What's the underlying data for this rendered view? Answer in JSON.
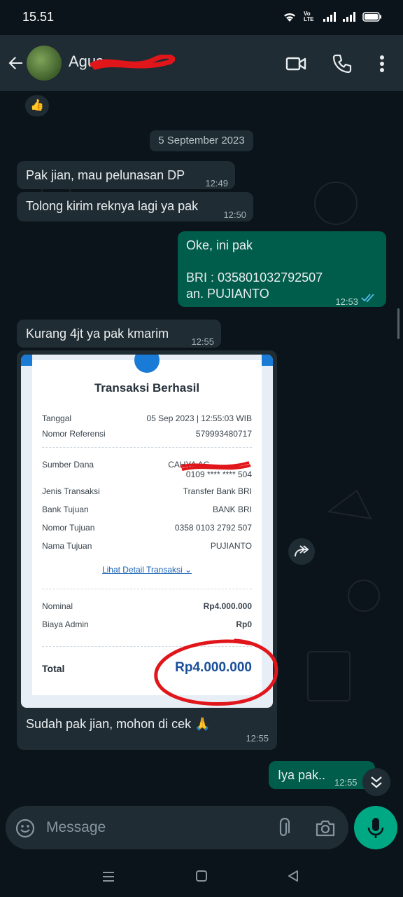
{
  "status_bar": {
    "time": "15.51",
    "network": "Vo LTE"
  },
  "header": {
    "contact_name": "Agus"
  },
  "chat": {
    "date_separator": "5 September 2023",
    "reaction": "👍",
    "messages": [
      {
        "text": "Pak jian, mau pelunasan DP",
        "time": "12:49"
      },
      {
        "text": "Tolong kirim reknya lagi ya pak",
        "time": "12:50"
      },
      {
        "line1": "Oke, ini pak",
        "line2": "BRI : 035801032792507",
        "line3": "an. PUJIANTO",
        "time": "12:53"
      },
      {
        "text": "Kurang 4jt ya pak kmarim",
        "time": "12:55"
      },
      {
        "caption": "Sudah pak jian, mohon di cek 🙏",
        "time": "12:55"
      },
      {
        "text": "Iya pak..",
        "time": "12:55"
      }
    ]
  },
  "receipt": {
    "title": "Transaksi Berhasil",
    "rows": [
      {
        "label": "Tanggal",
        "value": "05 Sep 2023 | 12:55:03 WIB"
      },
      {
        "label": "Nomor Referensi",
        "value": "579993480717"
      },
      {
        "label": "Sumber Dana",
        "value": "CAHYA AG",
        "value2": "0109 **** **** 504"
      },
      {
        "label": "Jenis Transaksi",
        "value": "Transfer Bank BRI"
      },
      {
        "label": "Bank Tujuan",
        "value": "BANK BRI"
      },
      {
        "label": "Nomor Tujuan",
        "value": "0358 0103 2792 507"
      },
      {
        "label": "Nama Tujuan",
        "value": "PUJIANTO"
      }
    ],
    "detail_link": "Lihat Detail Transaksi ⌄",
    "nominal": {
      "label": "Nominal",
      "value": "Rp4.000.000"
    },
    "admin": {
      "label": "Biaya Admin",
      "value": "Rp0"
    },
    "total": {
      "label": "Total",
      "value": "Rp4.000.000"
    }
  },
  "input": {
    "placeholder": "Message"
  },
  "colors": {
    "outgoing": "#005c4b",
    "incoming": "#202c33",
    "accent": "#00a884",
    "read_ticks": "#53bdeb",
    "annotation": "#e0161b"
  }
}
